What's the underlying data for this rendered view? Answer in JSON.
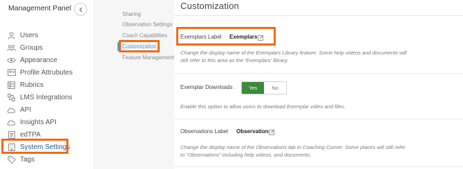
{
  "panel": {
    "title": "Management Panel",
    "nav": [
      {
        "label": "Users",
        "icon": "user-icon"
      },
      {
        "label": "Groups",
        "icon": "groups-icon"
      },
      {
        "label": "Appearance",
        "icon": "eye-icon"
      },
      {
        "label": "Profile Attrubutes",
        "icon": "profile-card-icon"
      },
      {
        "label": "Rubrics",
        "icon": "rubrics-grid-icon"
      },
      {
        "label": "LMS Integrations",
        "icon": "integrations-icon"
      },
      {
        "label": "API",
        "icon": "cloud-icon"
      },
      {
        "label": "Insights API",
        "icon": "cloud-icon"
      },
      {
        "label": "edTPA",
        "icon": "document-icon"
      },
      {
        "label": "System Settings",
        "icon": "building-icon",
        "active": true
      },
      {
        "label": "Tags",
        "icon": "tag-icon"
      }
    ]
  },
  "subnav": {
    "items": [
      {
        "label": "Sharing"
      },
      {
        "label": "Observation Settings"
      },
      {
        "label": "Coach Capabilities"
      },
      {
        "label": "Customization",
        "active": true
      },
      {
        "label": "Feature Management"
      }
    ]
  },
  "main": {
    "title": "Customization",
    "exemplars": {
      "label": "Exemplars Label",
      "value": "Exemplars",
      "help": "Change the display name of the Exemplars Library feature. Some help videos and documents will still refer to this area as the 'Exemplars' library."
    },
    "downloads": {
      "label": "Exemplar Downloads",
      "dot": ".",
      "yes": "Yes",
      "no": "No",
      "selected": "Yes",
      "help": "Enable this option to allow users to download Exemplar video and files."
    },
    "observations": {
      "label": "Observations Label",
      "value": "Observation",
      "help": "Change the display name of the Observations tab in Coaching Corner. Some places will still refer to \"Observations\" including help videos, and documents."
    }
  },
  "colors": {
    "highlight": "#f36a14",
    "toggle_on": "#3c8a3c",
    "active_link": "#4f9ad0"
  }
}
